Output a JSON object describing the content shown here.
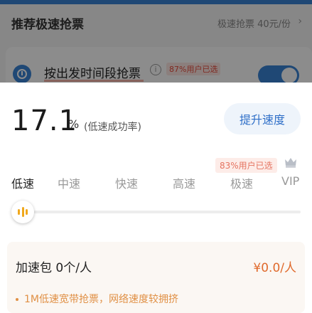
{
  "background": {
    "title": "推荐极速抢票",
    "subtitle": "极速抢票 40元/份",
    "item_label": "按出发时间段抢票",
    "item_badge": "87%用户已选",
    "toggle_on": true
  },
  "sheet": {
    "success_rate_value": "17.1",
    "success_rate_unit": "%",
    "success_rate_label": "(低速成功率)",
    "boost_button": "提升速度",
    "popular_badge": "83%用户已选",
    "tiers": [
      "低速",
      "中速",
      "快速",
      "高速",
      "极速",
      "VIP"
    ],
    "selected_tier": "低速",
    "package": {
      "title": "加速包 0个/人",
      "price": "¥0.0/人",
      "description": "1M低速宽带抢票，网络速度较拥挤"
    }
  },
  "colors": {
    "accent_blue": "#2f6fc8",
    "price_orange": "#e06a2c",
    "knob_yellow": "#f0a81c"
  }
}
